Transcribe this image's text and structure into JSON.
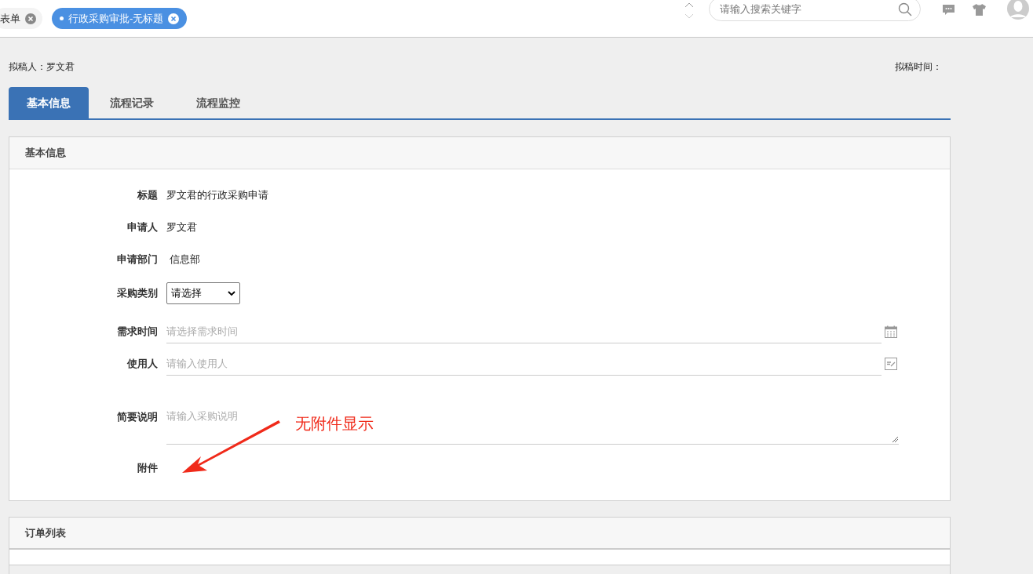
{
  "header": {
    "tabs": [
      {
        "label": "表单",
        "selected": false
      },
      {
        "label": "行政采购审批-无标题",
        "selected": true
      }
    ],
    "search": {
      "placeholder": "请输入搜索关键字"
    }
  },
  "meta": {
    "drafter": "拟稿人：罗文君",
    "draft_time": "拟稿时间："
  },
  "tabs": [
    {
      "label": "基本信息",
      "selected": true
    },
    {
      "label": "流程记录",
      "selected": false
    },
    {
      "label": "流程监控",
      "selected": false
    }
  ],
  "basic_panel": {
    "title": "基本信息",
    "fields": [
      {
        "kind": "text",
        "label": "标题",
        "value": "罗文君的行政采购申请"
      },
      {
        "kind": "text",
        "label": "申请人",
        "value": "罗文君"
      },
      {
        "kind": "text",
        "label": "申请部门",
        "value": " 信息部"
      },
      {
        "kind": "select",
        "label": "采购类别",
        "value": "请选择"
      },
      {
        "kind": "date",
        "label": "需求时间",
        "placeholder": "请选择需求时间"
      },
      {
        "kind": "picker",
        "label": "使用人",
        "placeholder": "请输入使用人"
      },
      {
        "kind": "textarea",
        "label": "简要说明",
        "placeholder": "请输入采购说明"
      },
      {
        "kind": "attachment",
        "label": "附件"
      }
    ]
  },
  "annotation": {
    "text": "无附件显示"
  },
  "order_panel": {
    "title": "订单列表"
  }
}
